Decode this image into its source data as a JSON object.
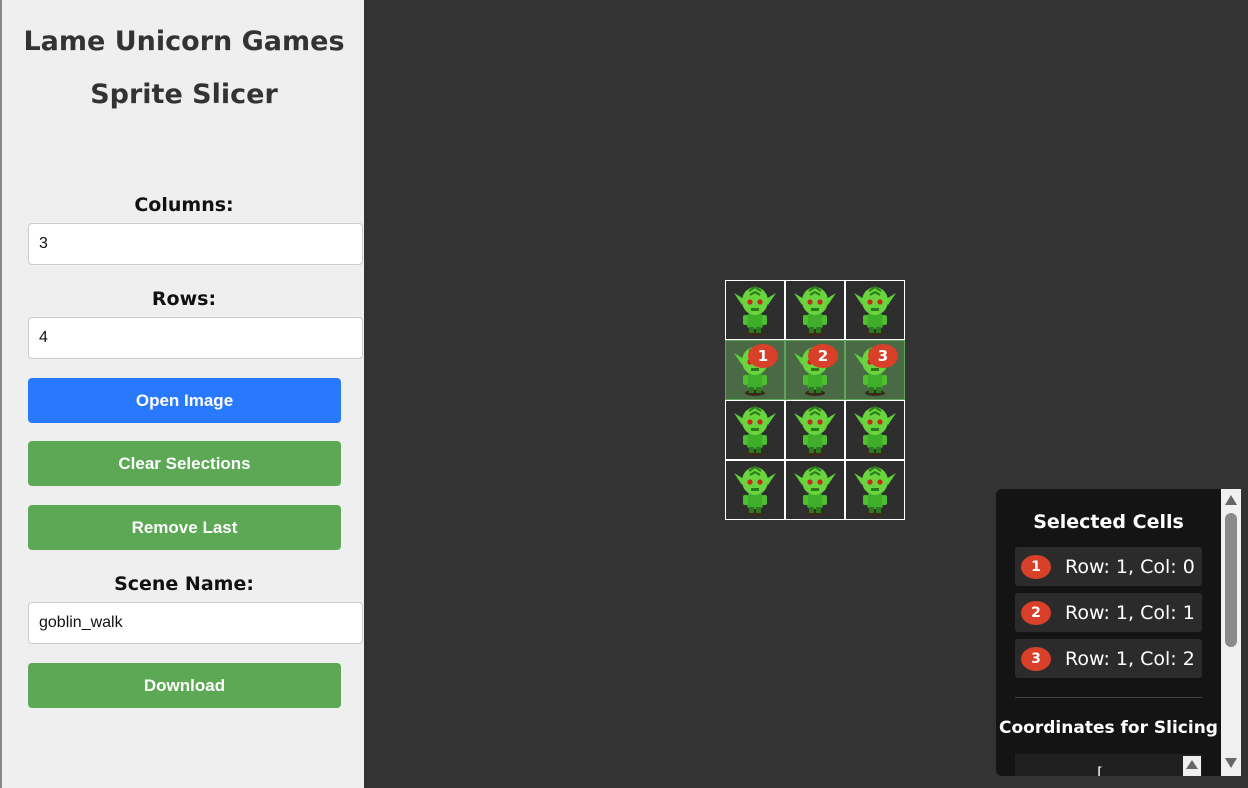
{
  "sidebar": {
    "title_line1": "Lame Unicorn Games",
    "title_line2": "Sprite Slicer",
    "columns_label": "Columns:",
    "columns_value": "3",
    "rows_label": "Rows:",
    "rows_value": "4",
    "open_image_label": "Open Image",
    "clear_selections_label": "Clear Selections",
    "remove_last_label": "Remove Last",
    "scene_name_label": "Scene Name:",
    "scene_name_value": "goblin_walk",
    "download_label": "Download"
  },
  "colors": {
    "primary_button": "#2979ff",
    "secondary_button": "#5ca855",
    "badge": "#d9402a",
    "canvas_background": "#333333"
  },
  "sprite_sheet": {
    "columns": 3,
    "rows": 4,
    "sprite": "green-goblin",
    "selected_badges": [
      "1",
      "2",
      "3"
    ]
  },
  "selected_panel": {
    "title": "Selected Cells",
    "items": [
      {
        "badge": "1",
        "text": "Row: 1, Col: 0"
      },
      {
        "badge": "2",
        "text": "Row: 1, Col: 1"
      },
      {
        "badge": "3",
        "text": "Row: 1, Col: 2"
      }
    ],
    "coords_title": "Coordinates for Slicing",
    "coords_text": "["
  }
}
